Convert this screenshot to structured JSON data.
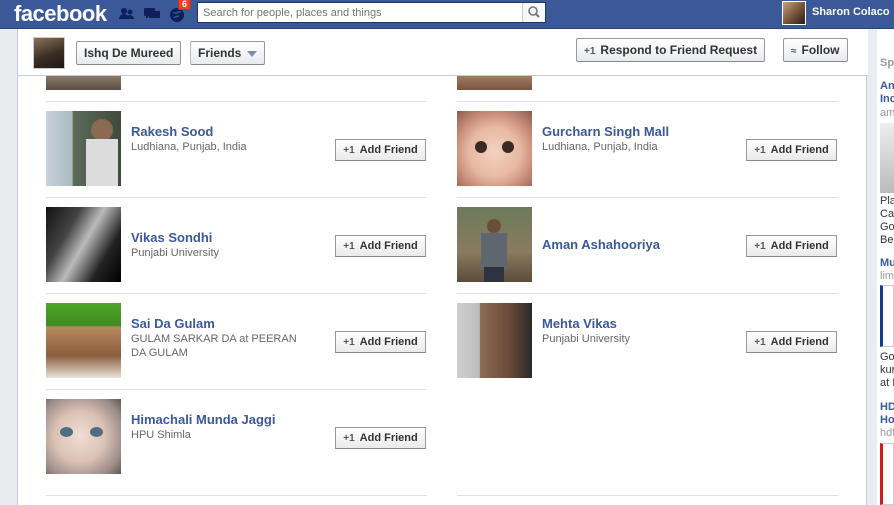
{
  "topbar": {
    "logo": "facebook",
    "notifications_count": "6",
    "search_placeholder": "Search for people, places and things",
    "user_name": "Sharon Colaco"
  },
  "header": {
    "page_name": "Ishq De Mureed",
    "friends_label": "Friends",
    "respond_label": "Respond to Friend Request",
    "follow_label": "Follow",
    "plus_glyph": "+1",
    "rss_glyph": "≈"
  },
  "friends": [
    {
      "name": "Rakesh Sood",
      "sub": "Ludhiana, Punjab, India",
      "add": "Add Friend"
    },
    {
      "name": "Gurcharn Singh Mall",
      "sub": "Ludhiana, Punjab, India",
      "add": "Add Friend"
    },
    {
      "name": "Vikas Sondhi",
      "sub": "Punjabi University",
      "add": "Add Friend"
    },
    {
      "name": "Aman Ashahooriya",
      "sub": "",
      "add": "Add Friend"
    },
    {
      "name": "Sai Da Gulam",
      "sub": "GULAM SARKAR DA at PEERAN DA GULAM",
      "add": "Add Friend"
    },
    {
      "name": "Mehta Vikas",
      "sub": "Punjabi University",
      "add": "Add Friend"
    },
    {
      "name": "Himachali Munda Jaggi",
      "sub": "HPU Shimla",
      "add": "Add Friend"
    }
  ],
  "right_column": {
    "items": [
      "Sp",
      "An",
      "Inc",
      "am",
      "Pla",
      "Car",
      "Gol",
      "Ber",
      "Mu",
      "lime",
      "Go",
      "kur",
      "at I",
      "HD",
      "Ho",
      "hdf"
    ]
  },
  "colors": {
    "brand_blue": "#3b5998",
    "link_blue": "#3b5998",
    "badge_red": "#f03d25"
  }
}
